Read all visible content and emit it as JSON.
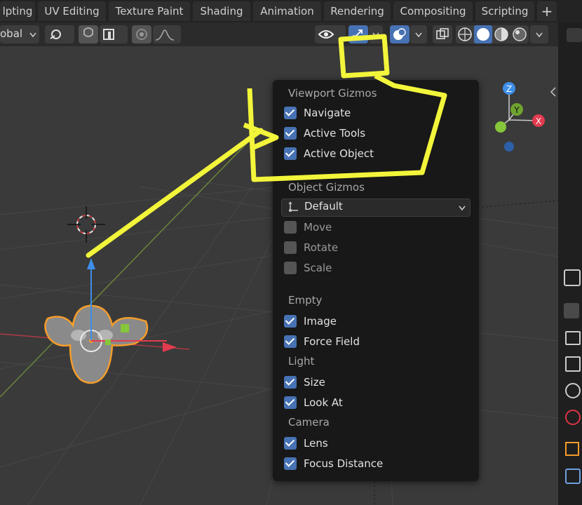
{
  "workspace_tabs": [
    "lpting",
    "UV Editing",
    "Texture Paint",
    "Shading",
    "Animation",
    "Rendering",
    "Compositing",
    "Scripting"
  ],
  "add_tab_label": "+",
  "header": {
    "orientation_label": "obal"
  },
  "axes": {
    "z": "Z",
    "y": "Y",
    "x": "X"
  },
  "popup": {
    "viewport_title": "Viewport Gizmos",
    "viewport_items": [
      {
        "label": "Navigate",
        "checked": true
      },
      {
        "label": "Active Tools",
        "checked": true
      },
      {
        "label": "Active Object",
        "checked": true
      }
    ],
    "object_title": "Object Gizmos",
    "object_dropdown": "Default",
    "object_items": [
      {
        "label": "Move",
        "checked": false
      },
      {
        "label": "Rotate",
        "checked": false
      },
      {
        "label": "Scale",
        "checked": false
      }
    ],
    "empty_title": "Empty",
    "empty_items": [
      {
        "label": "Image",
        "checked": true
      },
      {
        "label": "Force Field",
        "checked": true
      }
    ],
    "light_title": "Light",
    "light_items": [
      {
        "label": "Size",
        "checked": true
      },
      {
        "label": "Look At",
        "checked": true
      }
    ],
    "camera_title": "Camera",
    "camera_items": [
      {
        "label": "Lens",
        "checked": true
      },
      {
        "label": "Focus Distance",
        "checked": true
      }
    ]
  },
  "colors": {
    "accent": "#4772b3",
    "annotation": "#f2f53a",
    "selection": "#f39c2b"
  }
}
